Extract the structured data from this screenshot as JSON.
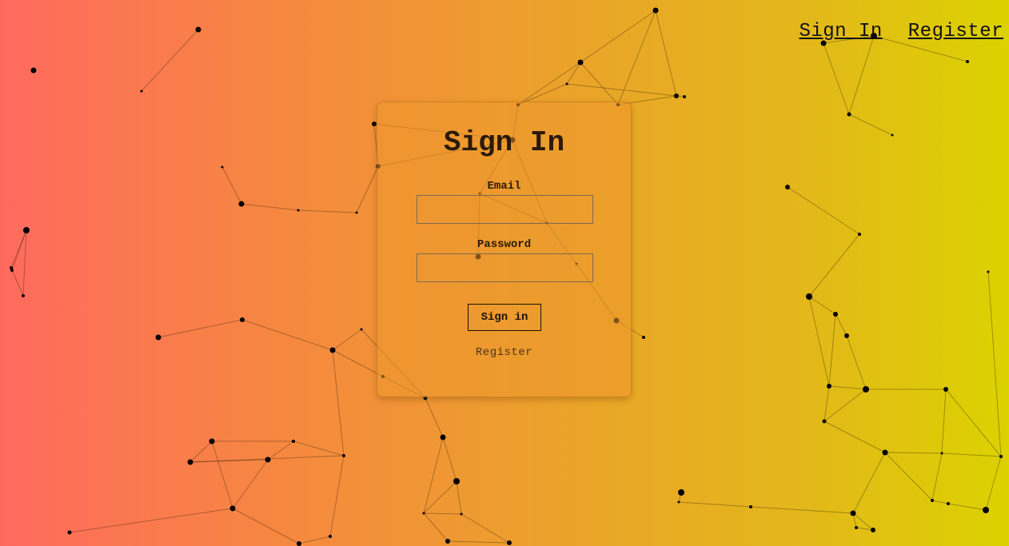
{
  "nav": {
    "signin_label": "Sign In",
    "register_label": "Register"
  },
  "form": {
    "title": "Sign In",
    "email_label": "Email",
    "email_value": "",
    "password_label": "Password",
    "password_value": "",
    "submit_label": "Sign in",
    "register_link": "Register"
  },
  "colors": {
    "gradient_start": "#ff6a5e",
    "gradient_end": "#dbd200"
  }
}
